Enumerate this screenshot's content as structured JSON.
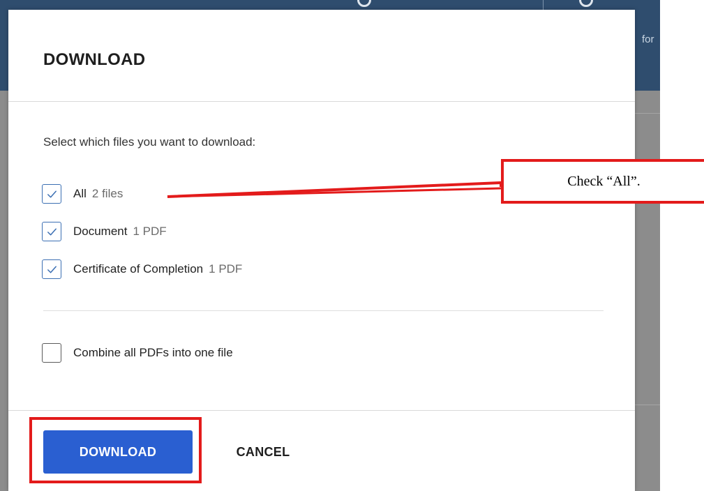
{
  "background": {
    "header_fragment": "for"
  },
  "dialog": {
    "title": "DOWNLOAD",
    "instruction": "Select which files you want to download:",
    "options": [
      {
        "label": "All",
        "meta": "2 files",
        "checked": true
      },
      {
        "label": "Document",
        "meta": "1 PDF",
        "checked": true
      },
      {
        "label": "Certificate of Completion",
        "meta": "1 PDF",
        "checked": true
      }
    ],
    "combine": {
      "label": "Combine all PDFs into one file",
      "checked": false
    },
    "buttons": {
      "download": "DOWNLOAD",
      "cancel": "CANCEL"
    }
  },
  "annotation": {
    "callout_text": "Check “All”.",
    "color": "#e31b1b"
  },
  "colors": {
    "primary": "#2a5fd1",
    "checkbox": "#3b6fb3",
    "header_bg": "#2f4d6e"
  },
  "icons": {
    "checkmark": "checkmark-icon"
  }
}
